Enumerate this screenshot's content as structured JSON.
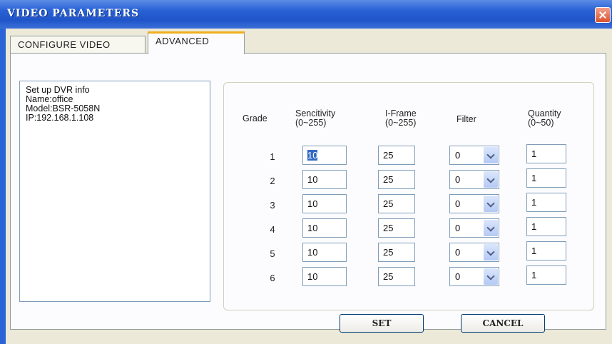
{
  "window": {
    "title": "VIDEO PARAMETERS"
  },
  "tabs": [
    {
      "label": "CONFIGURE VIDEO",
      "active": false
    },
    {
      "label": "ADVANCED",
      "active": true
    }
  ],
  "info": {
    "lines": [
      "Set up DVR info",
      "Name:office",
      "Model:BSR-5058N",
      "IP:192.168.1.108"
    ]
  },
  "table": {
    "headers": {
      "grade": "Grade",
      "sensitivity": [
        "Sencitivity",
        "(0~255)"
      ],
      "iframe": [
        "I-Frame",
        "(0~255)"
      ],
      "filter": "Filter",
      "quantity": [
        "Quantity",
        "(0~50)"
      ]
    },
    "rows": [
      {
        "grade": "1",
        "sensitivity": "10",
        "iframe": "25",
        "filter": "0",
        "quantity": "1"
      },
      {
        "grade": "2",
        "sensitivity": "10",
        "iframe": "25",
        "filter": "0",
        "quantity": "1"
      },
      {
        "grade": "3",
        "sensitivity": "10",
        "iframe": "25",
        "filter": "0",
        "quantity": "1"
      },
      {
        "grade": "4",
        "sensitivity": "10",
        "iframe": "25",
        "filter": "0",
        "quantity": "1"
      },
      {
        "grade": "5",
        "sensitivity": "10",
        "iframe": "25",
        "filter": "0",
        "quantity": "1"
      },
      {
        "grade": "6",
        "sensitivity": "10",
        "iframe": "25",
        "filter": "0",
        "quantity": "1"
      }
    ]
  },
  "buttons": {
    "set": "SET",
    "cancel": "CANCEL"
  },
  "icons": {
    "close": "close-icon",
    "dropdown": "chevron-down-icon"
  },
  "colors": {
    "titlebar": "#2a63d6",
    "tab_highlight": "#f1ae1e",
    "selection": "#316ac5"
  }
}
